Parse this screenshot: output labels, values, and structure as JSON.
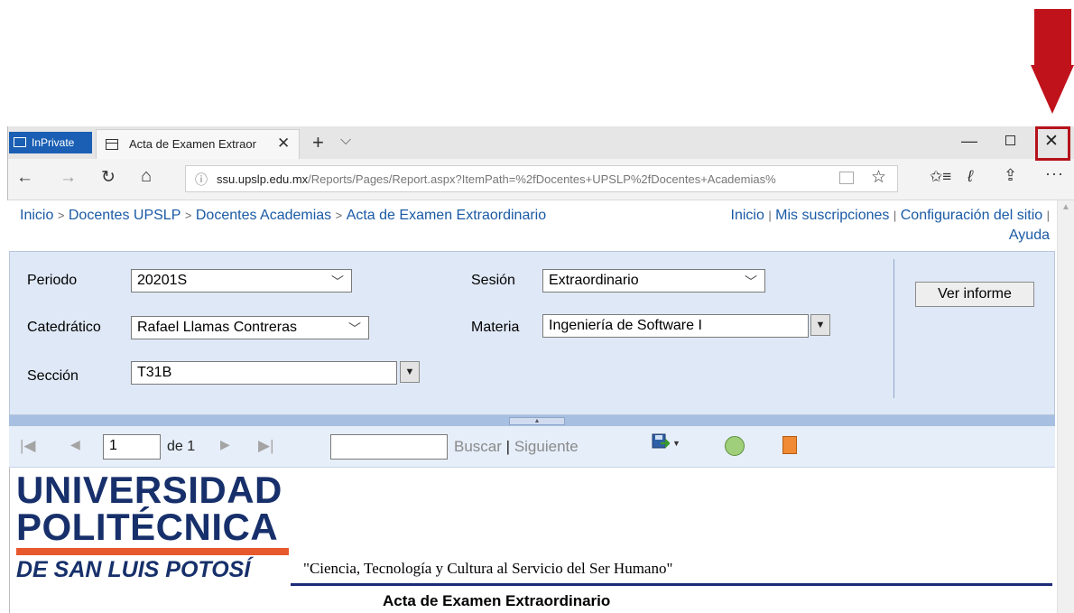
{
  "browser": {
    "inprivate_label": "InPrivate",
    "tab_title": "Acta de Examen Extraor",
    "url_domain": "ssu.upslp.edu.mx",
    "url_path": "/Reports/Pages/Report.aspx?ItemPath=%2fDocentes+UPSLP%2fDocentes+Academias%"
  },
  "header": {
    "breadcrumb": [
      "Inicio",
      "Docentes UPSLP",
      "Docentes Academias",
      "Acta de Examen Extraordinario"
    ],
    "breadcrumb_sep": ">",
    "links": [
      "Inicio",
      "Mis suscripciones",
      "Configuración del sitio",
      "Ayuda"
    ],
    "link_sep": "|"
  },
  "params": {
    "periodo": {
      "label": "Periodo",
      "value": "20201S"
    },
    "sesion": {
      "label": "Sesión",
      "value": "Extraordinario"
    },
    "catedratico": {
      "label": "Catedrático",
      "value": "Rafael Llamas Contreras"
    },
    "materia": {
      "label": "Materia",
      "value": "Ingeniería de Software I"
    },
    "seccion": {
      "label": "Sección",
      "value": "T31B"
    },
    "view_button": "Ver informe"
  },
  "toolbar": {
    "page_current": "1",
    "page_of": "de 1",
    "find_placeholder": "",
    "find_label": "Buscar",
    "find_sep": "|",
    "next_label": "Siguiente"
  },
  "report": {
    "logo_line1": "UNIVERSIDAD",
    "logo_line2": "POLITÉCNICA",
    "logo_line3": "DE SAN LUIS POTOSÍ",
    "motto": "\"Ciencia, Tecnología y Cultura al Servicio del Ser Humano\"",
    "title": "Acta de Examen Extraordinario"
  },
  "colors": {
    "annotation_red": "#c0121b",
    "link_blue": "#1a5aa5",
    "logo_navy": "#17306b",
    "logo_orange": "#e8582d",
    "param_panel": "#dfe8f6"
  }
}
